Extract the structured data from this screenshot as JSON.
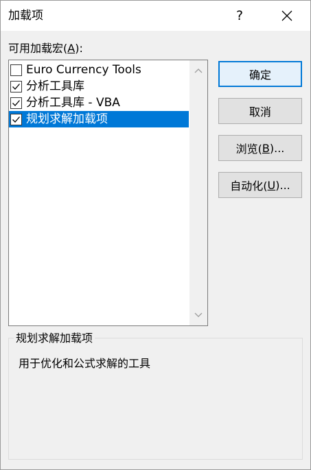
{
  "window": {
    "title": "加载项",
    "help_label": "?"
  },
  "list": {
    "label_prefix": "可用加载宏(",
    "label_key": "A",
    "label_suffix": "):",
    "items": [
      {
        "label": "Euro Currency Tools",
        "checked": false,
        "selected": false
      },
      {
        "label": "分析工具库",
        "checked": true,
        "selected": false
      },
      {
        "label": "分析工具库 - VBA",
        "checked": true,
        "selected": false
      },
      {
        "label": "规划求解加载项",
        "checked": true,
        "selected": true
      }
    ]
  },
  "buttons": {
    "ok": {
      "label": "确定"
    },
    "cancel": {
      "label": "取消"
    },
    "browse": {
      "prefix": "浏览(",
      "key": "B",
      "suffix": ")..."
    },
    "automation": {
      "prefix": "自动化(",
      "key": "U",
      "suffix": ")..."
    }
  },
  "details": {
    "title": "规划求解加载项",
    "description": "用于优化和公式求解的工具"
  },
  "colors": {
    "selection": "#0078d7",
    "default_button_border": "#0078d7"
  }
}
